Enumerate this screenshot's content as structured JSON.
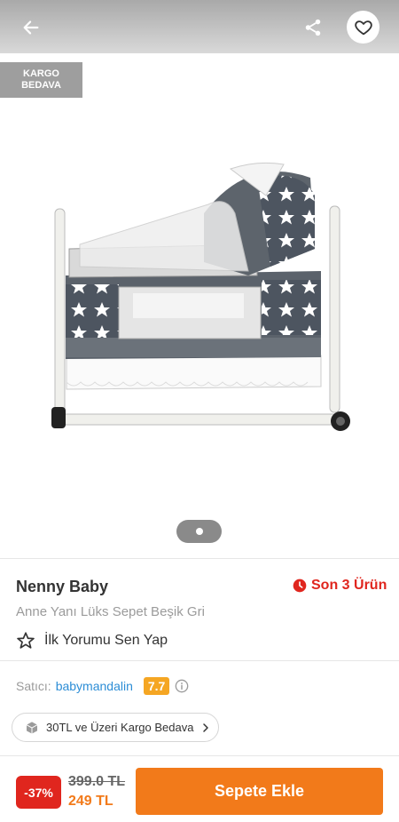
{
  "header": {
    "back_icon": "arrow-left-icon",
    "share_icon": "share-icon",
    "favorite_icon": "heart-icon"
  },
  "gallery": {
    "badge_line1": "KARGO",
    "badge_line2": "BEDAVA",
    "image_alt": "Anne Yanı Lüks Sepet Beşik Gri",
    "page_indicator": "1 of 1"
  },
  "product": {
    "brand": "Nenny Baby",
    "stock_label": "Son 3 Ürün",
    "name": "Anne Yanı Lüks Sepet Beşik Gri",
    "review_label": "İlk Yorumu Sen Yap"
  },
  "seller": {
    "label": "Satıcı:",
    "name": "babymandalin",
    "score": "7.7"
  },
  "shipping": {
    "label": "30TL ve Üzeri Kargo Bedava"
  },
  "checkout": {
    "discount": "-37%",
    "old_price": "399.0 TL",
    "new_price": "249 TL",
    "add_to_cart": "Sepete Ekle"
  },
  "colors": {
    "accent": "#f27a1a",
    "alert": "#e0261e",
    "link": "#2c8dd6",
    "score": "#f5a623"
  }
}
